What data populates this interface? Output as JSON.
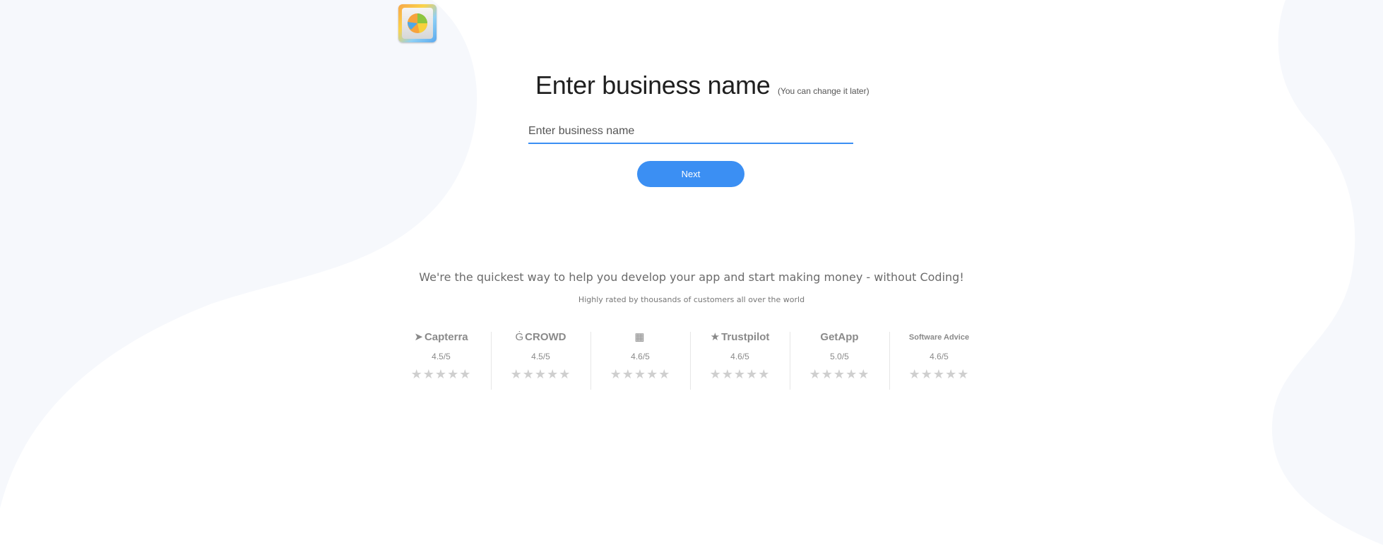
{
  "colors": {
    "accent": "#3b8ff3",
    "background_shape": "#f6f8fc",
    "star": "#cfcfcf"
  },
  "logo": {
    "icon": "pie-chart-app-logo"
  },
  "form": {
    "title": "Enter business name",
    "title_note": "(You can change it later)",
    "input_value": "",
    "input_placeholder": "Enter business name",
    "next_label": "Next"
  },
  "promo": {
    "tagline": "We're the quickest way to help you develop your app and start making money - without Coding!",
    "subline": "Highly rated by thousands of customers all over the world"
  },
  "ratings": [
    {
      "brand": "Capterra",
      "icon": "capterra-arrow-icon",
      "score": "4.5/5",
      "stars": "★★★★★"
    },
    {
      "brand": "CROWD",
      "icon": "g2-icon",
      "score": "4.5/5",
      "stars": "★★★★★"
    },
    {
      "brand": "",
      "icon": "square-logo-icon",
      "score": "4.6/5",
      "stars": "★★★★★"
    },
    {
      "brand": "Trustpilot",
      "icon": "star-icon",
      "score": "4.6/5",
      "stars": "★★★★★"
    },
    {
      "brand": "GetApp",
      "icon": "getapp-icon",
      "score": "5.0/5",
      "stars": "★★★★★"
    },
    {
      "brand": "Software Advice",
      "icon": "software-advice-icon",
      "score": "4.6/5",
      "stars": "★★★★★"
    }
  ]
}
